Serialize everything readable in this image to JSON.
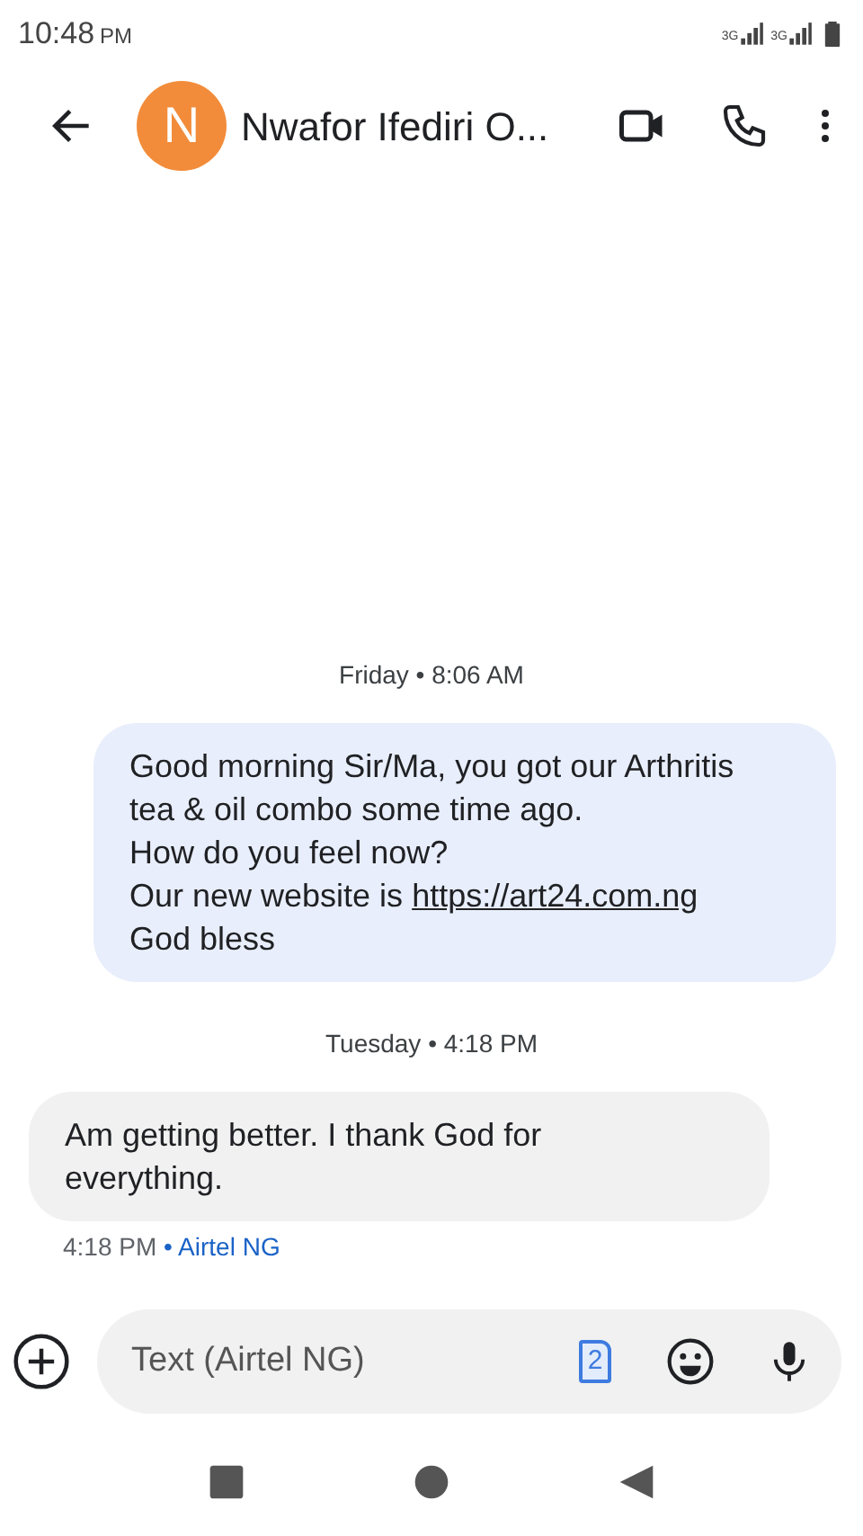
{
  "status_bar": {
    "time": "10:48",
    "ampm": "PM",
    "network_1": "3G",
    "network_2": "3G"
  },
  "header": {
    "avatar_letter": "N",
    "title": "Nwafor Ifediri O..."
  },
  "messages": [
    {
      "kind": "date",
      "text": "Friday • 8:06 AM"
    },
    {
      "kind": "outgoing",
      "parts": [
        {
          "text": "Good morning Sir/Ma, you got our Arthritis tea & oil combo some time ago.\nHow do you feel now?\nOur new website is "
        },
        {
          "link": "https://art24.com.ng"
        },
        {
          "text": "\nGod bless"
        }
      ]
    },
    {
      "kind": "date",
      "text": "Tuesday • 4:18 PM"
    },
    {
      "kind": "incoming",
      "parts": [
        {
          "text": "Am getting better. I thank God for everything."
        }
      ],
      "time": "4:18 PM",
      "sim": "• Airtel NG"
    }
  ],
  "compose": {
    "placeholder": "Text (Airtel NG)",
    "sim_number": "2"
  }
}
